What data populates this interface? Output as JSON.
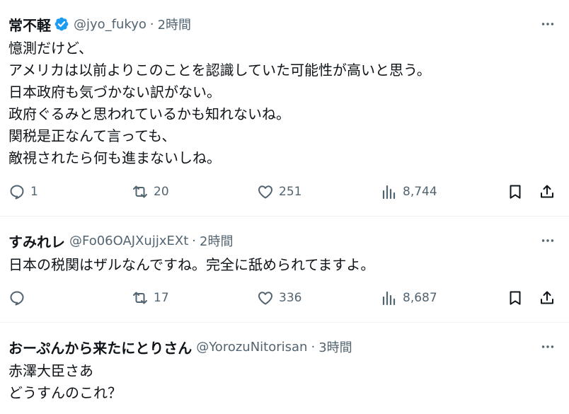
{
  "tweets": [
    {
      "name": "常不軽",
      "verified": true,
      "handle": "@jyo_fukyo",
      "dot": "·",
      "time": "2時間",
      "lines": [
        "憶測だけど、",
        "アメリカは以前よりこのことを認識していた可能性が高いと思う。",
        "日本政府も気づかない訳がない。",
        "政府ぐるみと思われているかも知れないね。",
        "関税是正なんて言っても、",
        "敵視されたら何も進まないしね。"
      ],
      "replies": "1",
      "retweets": "20",
      "likes": "251",
      "views": "8,744"
    },
    {
      "name": "すみれレ",
      "verified": false,
      "handle": "@Fo06OAJXujjxEXt",
      "dot": "·",
      "time": "2時間",
      "lines": [
        "日本の税関はザルなんですね。完全に舐められてますよ。"
      ],
      "replies": "",
      "retweets": "17",
      "likes": "336",
      "views": "8,687"
    },
    {
      "name": "おーぷんから来たにとりさん",
      "verified": false,
      "handle": "@YorozuNitorisan",
      "dot": "·",
      "time": "3時間",
      "lines": [
        "赤澤大臣さあ",
        "どうすんのこれ？"
      ]
    }
  ],
  "icons": {
    "reply": "reply-icon",
    "retweet": "retweet-icon",
    "like": "heart-icon",
    "views": "views-icon",
    "bookmark": "bookmark-icon",
    "share": "share-icon",
    "more": "more-icon",
    "verified": "verified-badge-icon"
  },
  "colors": {
    "text": "#0f1419",
    "muted": "#536471",
    "verified": "#1d9bf0",
    "separator": "#eff3f4"
  }
}
